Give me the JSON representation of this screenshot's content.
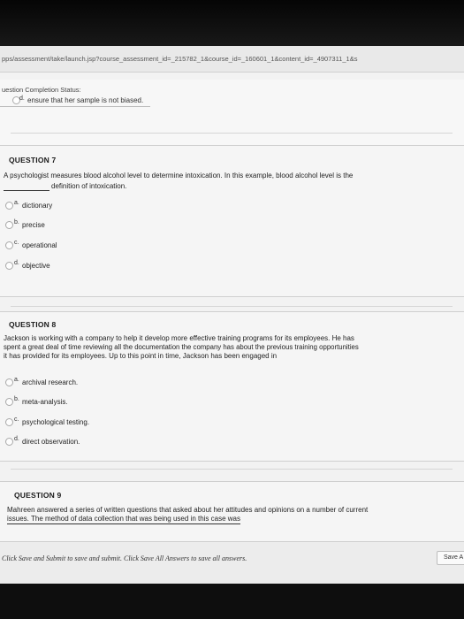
{
  "browser": {
    "url": "pps/assessment/take/launch.jsp?course_assessment_id=_215782_1&course_id=_160601_1&content_id=_4907311_1&s"
  },
  "status_panel": {
    "label": "uestion Completion Status:",
    "previous_answer": {
      "letter": "d.",
      "text": "ensure that her sample is not biased."
    }
  },
  "questions": [
    {
      "title": "QUESTION 7",
      "text_line1": "A psychologist measures blood alcohol level to determine intoxication. In this example, blood alcohol level is the",
      "text_line2": "definition of intoxication.",
      "options": [
        {
          "letter": "a.",
          "text": "dictionary"
        },
        {
          "letter": "b.",
          "text": "precise"
        },
        {
          "letter": "c.",
          "text": "operational"
        },
        {
          "letter": "d.",
          "text": "objective"
        }
      ]
    },
    {
      "title": "QUESTION 8",
      "text_line1": "Jackson is working with a company to help it develop more effective training programs for its employees. He has",
      "text_line2": "spent a great deal of time reviewing all the documentation the company has about the previous training opportunities",
      "text_line3": "it has provided for its employees. Up to this point in time, Jackson has been engaged in",
      "options": [
        {
          "letter": "a.",
          "text": "archival research."
        },
        {
          "letter": "b.",
          "text": "meta-analysis."
        },
        {
          "letter": "c.",
          "text": "psychological testing."
        },
        {
          "letter": "d.",
          "text": "direct observation."
        }
      ]
    },
    {
      "title": "QUESTION 9",
      "text_line1": "Mahreen answered a series of written questions that asked about her attitudes and opinions on a number of current",
      "text_line2": "issues. The method of data collection that was being used in this case was"
    }
  ],
  "footer": {
    "instruction": "Click Save and Submit to save and submit. Click Save All Answers to save all answers.",
    "save_button": "Save A"
  }
}
